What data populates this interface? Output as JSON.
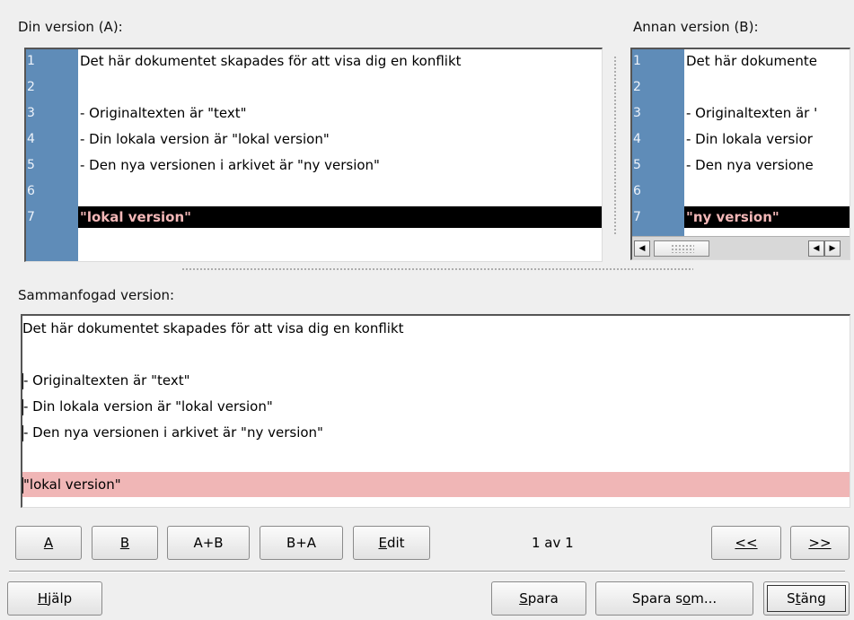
{
  "labels": {
    "a": "Din version (A):",
    "b": "Annan version (B):",
    "merged": "Sammanfogad version:"
  },
  "pane_a": {
    "lines": [
      {
        "num": "1",
        "text": "Det här dokumentet skapades för att visa dig en konflikt"
      },
      {
        "num": "2",
        "text": ""
      },
      {
        "num": "3",
        "text": "- Originaltexten är \"text\""
      },
      {
        "num": "4",
        "text": "- Din lokala version är \"lokal version\""
      },
      {
        "num": "5",
        "text": "- Den nya versionen i arkivet är \"ny version\""
      },
      {
        "num": "6",
        "text": ""
      },
      {
        "num": "7",
        "text": "\"lokal version\""
      }
    ]
  },
  "pane_b": {
    "lines": [
      {
        "num": "1",
        "text": "Det här dokumente"
      },
      {
        "num": "2",
        "text": ""
      },
      {
        "num": "3",
        "text": "- Originaltexten är '"
      },
      {
        "num": "4",
        "text": "- Din lokala versior"
      },
      {
        "num": "5",
        "text": "- Den nya versione"
      },
      {
        "num": "6",
        "text": ""
      },
      {
        "num": "7",
        "text": "\"ny version\""
      }
    ],
    "scroll_left": "◀",
    "scroll_right": "▶",
    "scroll_left2": "◀"
  },
  "merged": {
    "lines": [
      "Det här dokumentet skapades för att visa dig en konflikt",
      "",
      "- Originaltexten är \"text\"",
      "- Din lokala version är \"lokal version\"",
      "- Den nya versionen i arkivet är \"ny version\"",
      "",
      "\"lokal version\""
    ]
  },
  "conflict_buttons": {
    "a": "A",
    "b": "B",
    "ab": "A+B",
    "ba": "B+A",
    "edit": "Edit",
    "counter": "1 av 1",
    "prev": "<<",
    "next": ">>"
  },
  "dialog_buttons": {
    "help": "Hjälp",
    "save": "Spara",
    "save_as": "Spara som...",
    "close": "Stäng"
  },
  "colors": {
    "gutter": "#5f8cb8",
    "conflict_highlight": "#000000",
    "conflict_text": "#f3b7b7",
    "merged_conflict_bg": "#f0b6b6"
  }
}
